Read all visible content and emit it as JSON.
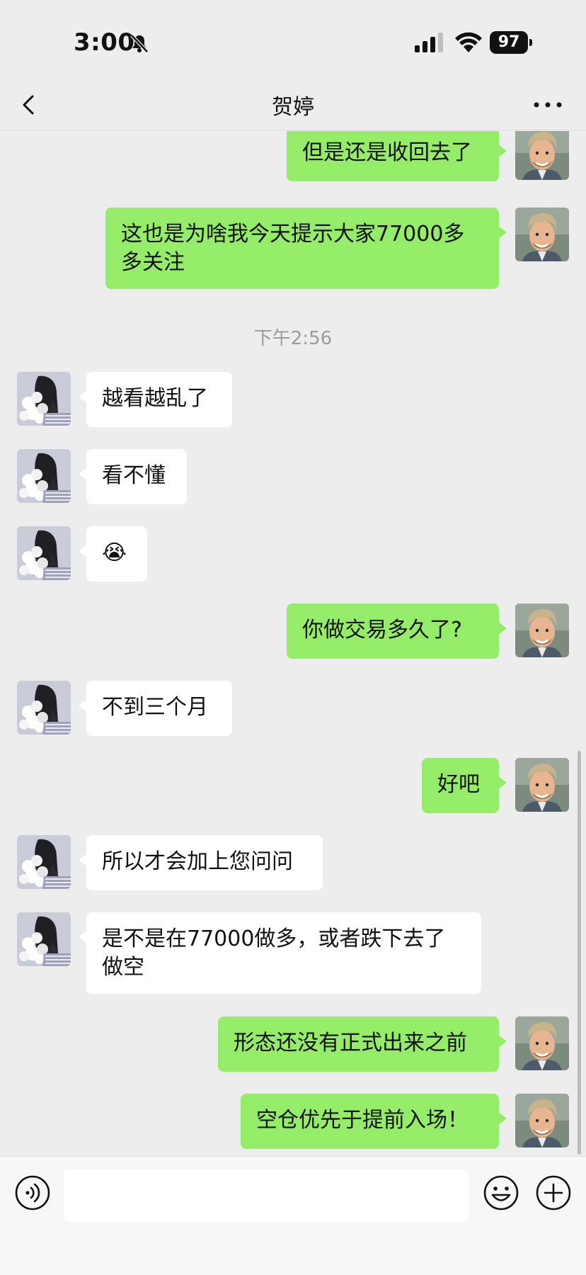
{
  "status_bar": {
    "time": "3:00",
    "battery": "97"
  },
  "header": {
    "title": "贺婷"
  },
  "messages": [
    {
      "side": "me",
      "text": "但是还是收回去了"
    },
    {
      "side": "me",
      "text": "这也是为啥我今天提示大家77000多多关注"
    },
    {
      "type": "timestamp",
      "text": "下午2:56"
    },
    {
      "side": "her",
      "text": "越看越乱了"
    },
    {
      "side": "her",
      "text": "看不懂"
    },
    {
      "side": "her",
      "text": "😭"
    },
    {
      "side": "me",
      "text": "你做交易多久了?"
    },
    {
      "side": "her",
      "text": "不到三个月"
    },
    {
      "side": "me",
      "text": "好吧"
    },
    {
      "side": "her",
      "text": "所以才会加上您问问"
    },
    {
      "side": "her",
      "text": "是不是在77000做多，或者跌下去了做空"
    },
    {
      "side": "me",
      "text": "形态还没有正式出来之前"
    },
    {
      "side": "me",
      "text": "空仓优先于提前入场！"
    }
  ],
  "input": {
    "value": "",
    "placeholder": ""
  },
  "colors": {
    "bubble_me": "#95ec69",
    "bubble_her": "#ffffff",
    "background": "#ededed"
  },
  "icons": [
    "back-icon",
    "more-icon",
    "bell-off-icon",
    "signal-icon",
    "wifi-icon",
    "voice-icon",
    "emoji-icon",
    "plus-icon"
  ]
}
